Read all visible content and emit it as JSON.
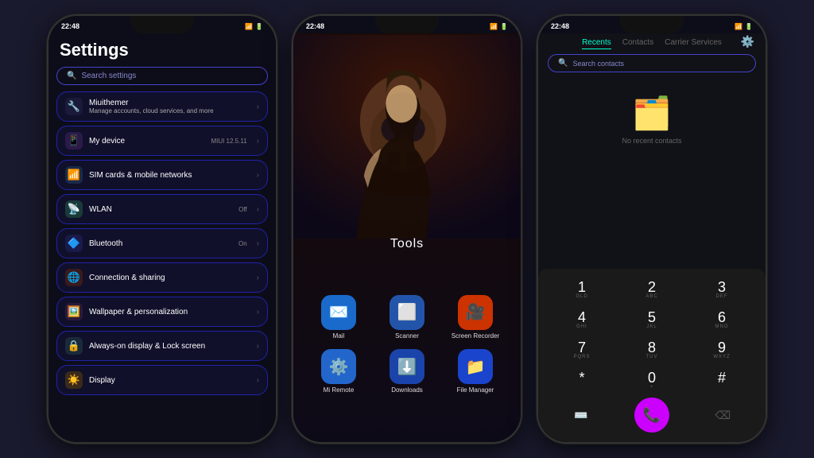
{
  "phone1": {
    "statusBar": {
      "time": "22:48"
    },
    "title": "Settings",
    "search": {
      "placeholder": "Search settings",
      "icon": "🔍"
    },
    "items": [
      {
        "id": "miuithemer",
        "icon": "🔧",
        "iconBg": "#1a1a3a",
        "title": "Miuithemer",
        "sub": "Manage accounts, cloud services, and more",
        "badge": "",
        "hasChevron": true
      },
      {
        "id": "my-device",
        "icon": "📱",
        "iconBg": "#2a1a4a",
        "title": "My device",
        "sub": "",
        "badge": "MIUI 12.5.11",
        "hasChevron": true
      },
      {
        "id": "sim-cards",
        "icon": "📶",
        "iconBg": "#1a2a4a",
        "title": "SIM cards & mobile networks",
        "sub": "",
        "badge": "",
        "hasChevron": true
      },
      {
        "id": "wlan",
        "icon": "📡",
        "iconBg": "#1a3a3a",
        "title": "WLAN",
        "sub": "",
        "badge": "Off",
        "hasChevron": true
      },
      {
        "id": "bluetooth",
        "icon": "🔷",
        "iconBg": "#1a1a4a",
        "title": "Bluetooth",
        "sub": "",
        "badge": "On",
        "hasChevron": true
      },
      {
        "id": "connection-sharing",
        "icon": "🌐",
        "iconBg": "#3a1a1a",
        "title": "Connection & sharing",
        "sub": "",
        "badge": "",
        "hasChevron": true
      },
      {
        "id": "wallpaper",
        "icon": "🖼️",
        "iconBg": "#2a1a3a",
        "title": "Wallpaper & personalization",
        "sub": "",
        "badge": "",
        "hasChevron": true
      },
      {
        "id": "always-on",
        "icon": "🔒",
        "iconBg": "#1a2a3a",
        "title": "Always-on display & Lock screen",
        "sub": "",
        "badge": "",
        "hasChevron": true
      },
      {
        "id": "display",
        "icon": "☀️",
        "iconBg": "#3a2a1a",
        "title": "Display",
        "sub": "",
        "badge": "",
        "hasChevron": true
      }
    ]
  },
  "phone2": {
    "statusBar": {
      "time": "22:48"
    },
    "folderTitle": "Tools",
    "apps": [
      {
        "id": "mail",
        "icon": "✉️",
        "iconBg": "#1a6acc",
        "label": "Mail"
      },
      {
        "id": "scanner",
        "icon": "⬜",
        "iconBg": "#2255aa",
        "label": "Scanner"
      },
      {
        "id": "screen-recorder",
        "icon": "🎥",
        "iconBg": "#cc3300",
        "label": "Screen\nRecorder"
      },
      {
        "id": "mi-remote",
        "icon": "⚙️",
        "iconBg": "#2266cc",
        "label": "Mi Remote"
      },
      {
        "id": "downloads",
        "icon": "⬇️",
        "iconBg": "#1a44aa",
        "label": "Downloads"
      },
      {
        "id": "file-manager",
        "icon": "📁",
        "iconBg": "#1a44cc",
        "label": "File Manager"
      }
    ]
  },
  "phone3": {
    "statusBar": {
      "time": "22:48"
    },
    "tabs": [
      {
        "id": "recents",
        "label": "Recents",
        "active": true
      },
      {
        "id": "contacts",
        "label": "Contacts",
        "active": false
      },
      {
        "id": "carrier",
        "label": "Carrier Services",
        "active": false
      }
    ],
    "search": {
      "placeholder": "Search contacts"
    },
    "emptyText": "No recent contacts",
    "dialpad": {
      "keys": [
        {
          "num": "1",
          "sub": "GLD"
        },
        {
          "num": "2",
          "sub": "ABC"
        },
        {
          "num": "3",
          "sub": "DEF"
        },
        {
          "num": "4",
          "sub": "GHI"
        },
        {
          "num": "5",
          "sub": "JKL"
        },
        {
          "num": "6",
          "sub": "MNO"
        },
        {
          "num": "7",
          "sub": "PQRS"
        },
        {
          "num": "8",
          "sub": "TUV"
        },
        {
          "num": "9",
          "sub": "WXYZ"
        },
        {
          "num": "*",
          "sub": ""
        },
        {
          "num": "0",
          "sub": "+"
        },
        {
          "num": "#",
          "sub": ""
        }
      ],
      "callIcon": "📞"
    }
  }
}
